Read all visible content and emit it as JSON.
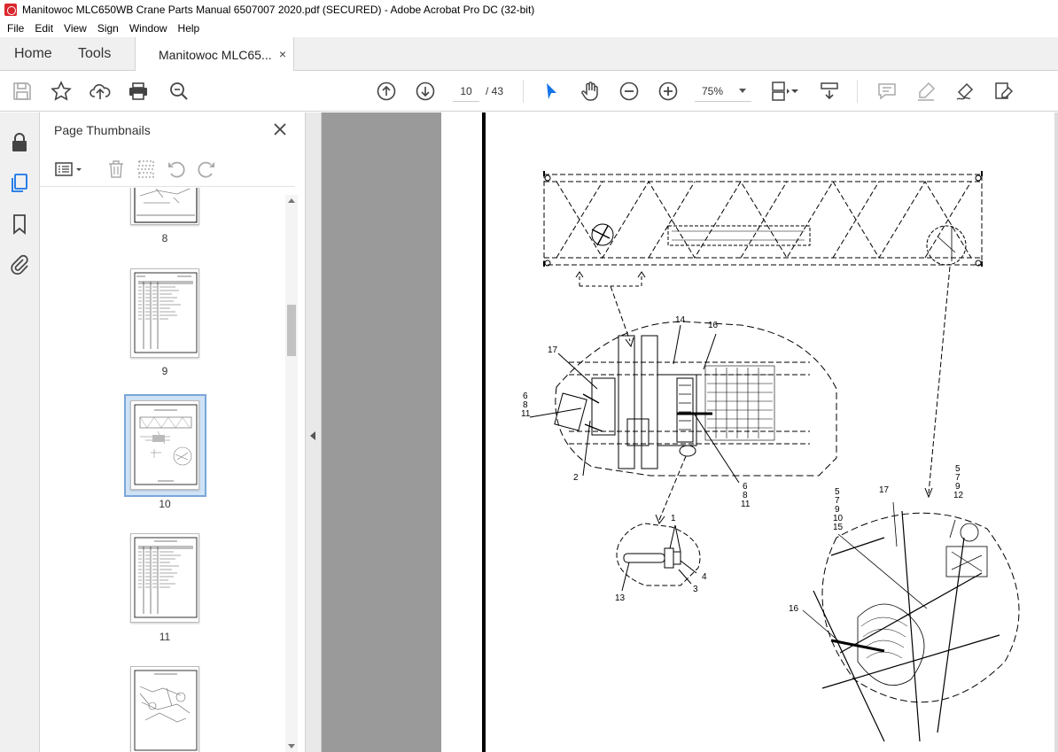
{
  "window": {
    "title": "Manitowoc MLC650WB Crane Parts Manual 6507007 2020.pdf (SECURED) - Adobe Acrobat Pro DC (32-bit)"
  },
  "menu": {
    "items": [
      "File",
      "Edit",
      "View",
      "Sign",
      "Window",
      "Help"
    ]
  },
  "tabs": {
    "home": "Home",
    "tools": "Tools",
    "document": "Manitowoc MLC65...",
    "close_glyph": "×"
  },
  "toolbar": {
    "page_current": "10",
    "page_total": "/ 43",
    "zoom": "75%",
    "icons": [
      "save-icon",
      "bookmark-star-icon",
      "upload-icon",
      "print-icon",
      "find-zoom-icon",
      "page-up-icon",
      "page-down-icon",
      "select-arrow-icon",
      "hand-icon",
      "zoom-out-icon",
      "zoom-in-icon",
      "page-fit-icon",
      "scroll-mode-icon",
      "comment-icon",
      "highlight-icon",
      "sign-icon",
      "fill-sign-icon"
    ]
  },
  "sidebar": {
    "icons": [
      "lock-icon",
      "page-thumbnails-icon",
      "bookmarks-icon",
      "attachments-icon"
    ]
  },
  "thumbnails_panel": {
    "title": "Page Thumbnails",
    "close_glyph": "×",
    "pages": [
      {
        "number": "8",
        "selected": false
      },
      {
        "number": "9",
        "selected": false
      },
      {
        "number": "10",
        "selected": true
      },
      {
        "number": "11",
        "selected": false
      },
      {
        "number": "12",
        "selected": false
      }
    ]
  },
  "document": {
    "callouts": {
      "c14": "14",
      "c16a": "16",
      "c17a": "17",
      "c6a": "6",
      "c8a": "8",
      "c11a": "11",
      "c2": "2",
      "c6b": "6",
      "c8b": "8",
      "c11b": "11",
      "c1": "1",
      "c4": "4",
      "c3": "3",
      "c13": "13",
      "c17b": "17",
      "c5a": "5",
      "c7a": "7",
      "c9a": "9",
      "c10": "10",
      "c15": "15",
      "c5b": "5",
      "c7b": "7",
      "c9b": "9",
      "c12": "12",
      "c16b": "16"
    }
  }
}
